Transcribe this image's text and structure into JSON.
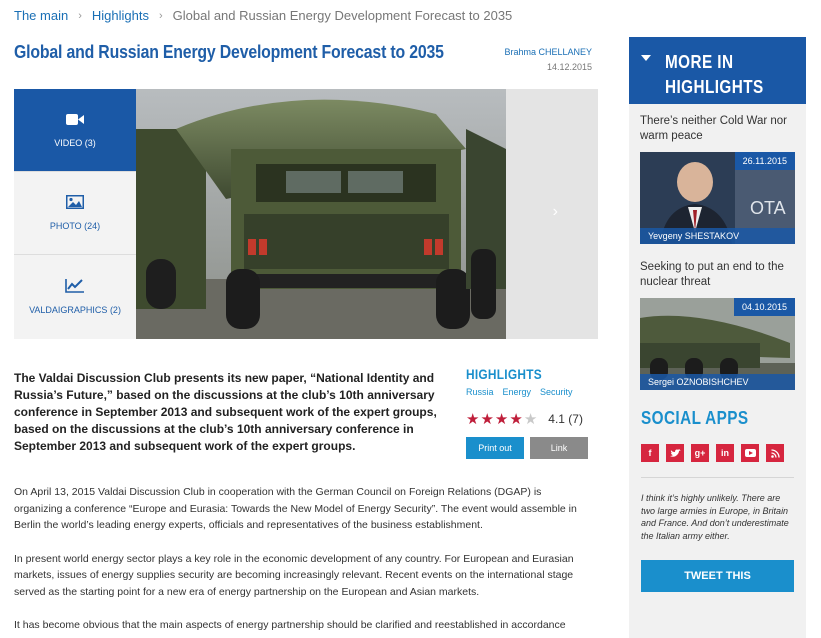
{
  "breadcrumb": {
    "home": "The main",
    "section": "Highlights",
    "current": "Global and Russian Energy Development Forecast to 2035"
  },
  "article": {
    "title": "Global and Russian Energy Development Forecast to 2035",
    "author_first": "Brahma",
    "author_last": "CHELLANEY",
    "date": "14.12.2015"
  },
  "media": {
    "tabs": [
      {
        "label": "VIDEO",
        "count": "(3)",
        "icon": "video-camera-icon"
      },
      {
        "label": "PHOTO",
        "count": "(24)",
        "icon": "image-icon"
      },
      {
        "label": "VALDAIGRAPHICS",
        "count": "(2)",
        "icon": "line-chart-icon"
      }
    ],
    "next_label": "›"
  },
  "lead": "The Valdai Discussion Club presents its new paper, “National Identity and Russia’s Future,” based on the discussions at the club’s 10th anniversary conference in September 2013 and subsequent work of the expert groups, based on the discussions at the club’s 10th anniversary conference in September 2013 and subsequent work of the expert groups.",
  "highlights": {
    "title": "HIGHLIGHTS",
    "tags": [
      "Russia",
      "Energy",
      "Security"
    ],
    "rating_value": "4.1",
    "rating_count": "(7)",
    "stars_filled": 4,
    "stars_total": 5,
    "print_label": "Print out",
    "link_label": "Link"
  },
  "body": [
    "On April 13, 2015 Valdai Discussion Club in cooperation with the German Council on Foreign Relations (DGAP) is organizing a conference “Europe and Eurasia: Towards the New Model of Energy Security”. The event would assemble in Berlin the world’s leading energy experts, officials and representatives of the business establishment.",
    "In present world energy sector plays a key role in the economic development of any country. For European and Eurasian markets, issues of energy supplies security are becoming increasingly relevant. Recent events on the international stage served as the starting point for a new era of energy partnership on the European and Asian markets.",
    "It has become obvious that the main aspects of energy partnership should be clarified and reestablished in accordance"
  ],
  "sidebar": {
    "more_title": "MORE IN HIGHLIGHTS",
    "articles": [
      {
        "headline": "There’s neither Cold War nor warm peace",
        "date": "26.11.2015",
        "author_first": "Yevgeny",
        "author_last": "SHESTAKOV"
      },
      {
        "headline": "Seeking to put an end to the nuclear threat",
        "date": "04.10.2015",
        "author_first": "Sergei",
        "author_last": "OZNOBISHCHEV"
      }
    ],
    "social_title": "SOCIAL APPS",
    "social_icons": [
      "facebook-icon",
      "twitter-icon",
      "google-plus-icon",
      "linkedin-icon",
      "youtube-icon",
      "rss-icon"
    ],
    "quote": "I think it’s highly unlikely. There are two large armies in Europe, in Britain and France. And don’t underestimate the Italian army either.",
    "tweet_label": "TWEET THIS"
  },
  "colors": {
    "brand_blue": "#1a58a6",
    "link_blue": "#1a8fcc",
    "accent_red": "#d6263f"
  }
}
